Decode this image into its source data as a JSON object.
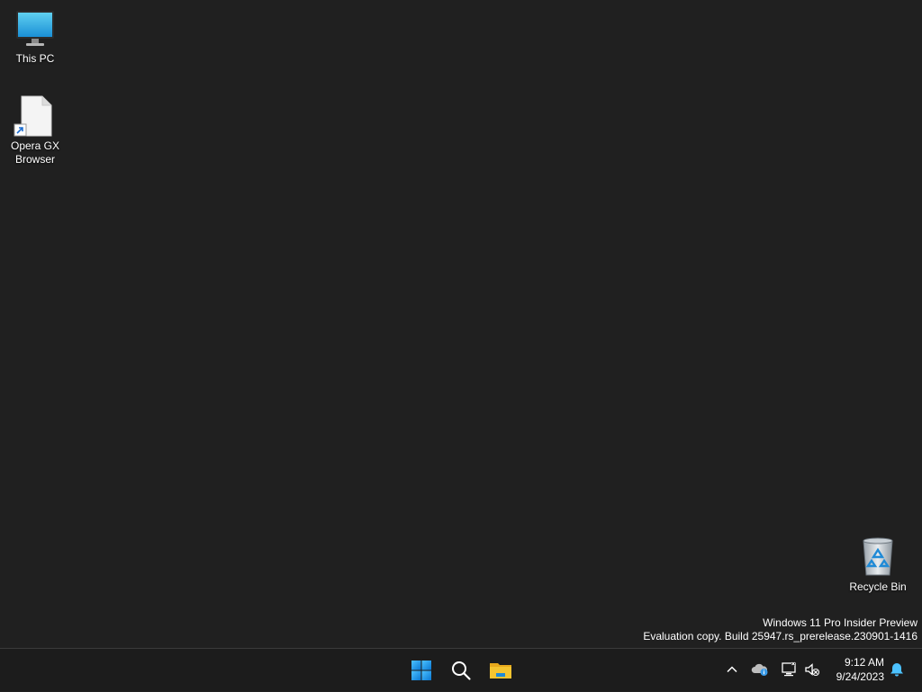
{
  "desktop": {
    "icons": [
      {
        "label": "This PC",
        "icon": "monitor-icon"
      },
      {
        "label": "Opera GX\nBrowser",
        "icon": "blank-file-shortcut-icon"
      },
      {
        "label": "Recycle Bin",
        "icon": "recycle-bin-icon"
      }
    ],
    "watermark": {
      "line1": "Windows 11 Pro Insider Preview",
      "line2": "Evaluation copy. Build 25947.rs_prerelease.230901-1416"
    }
  },
  "taskbar": {
    "buttons": [
      {
        "name": "start",
        "icon": "windows-logo-icon"
      },
      {
        "name": "search",
        "icon": "search-icon"
      },
      {
        "name": "file-explorer",
        "icon": "folder-icon"
      }
    ],
    "tray": {
      "chevron_icon": "chevron-up-icon",
      "onedrive_icon": "onedrive-cloud-icon",
      "network_icon": "network-disconnected-icon",
      "volume_icon": "volume-muted-icon",
      "notification_icon": "bell-icon"
    },
    "clock": {
      "time": "9:12 AM",
      "date": "9/24/2023"
    }
  },
  "colors": {
    "desktop_bg": "#202020",
    "taskbar_bg": "#1c1c1c",
    "accent": "#3a9be8",
    "folder_yellow": "#f4c430"
  }
}
